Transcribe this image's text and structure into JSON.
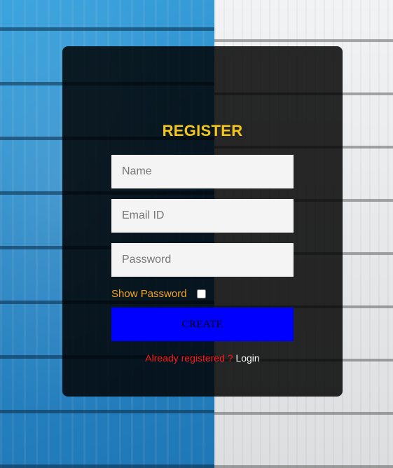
{
  "background": {
    "left_color": "#2f8fcf",
    "right_color": "#e6e8ea"
  },
  "card": {
    "title": "REGISTER",
    "title_color": "#f5c518",
    "fields": {
      "name_placeholder": "Name",
      "email_placeholder": "Email ID",
      "password_placeholder": "Password"
    },
    "show_password": {
      "label": "Show Password",
      "checked": false
    },
    "create_button": {
      "label": "CREATE",
      "color": "#0000ff"
    },
    "footer": {
      "prompt": "Already registered ?",
      "link_label": "Login"
    }
  }
}
